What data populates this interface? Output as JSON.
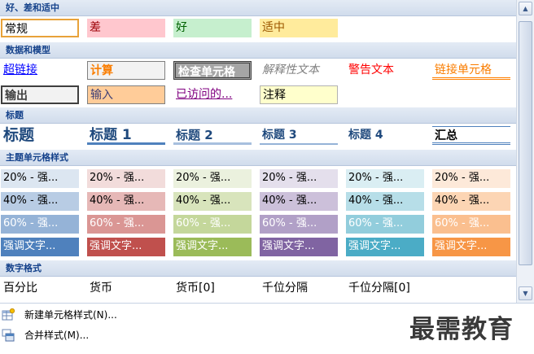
{
  "sections": [
    {
      "title": "好、差和适中",
      "cells": [
        {
          "label": "常规",
          "bg": "#ffffff",
          "fg": "#000000",
          "border": "2px solid #e8a23a",
          "weight": "normal"
        },
        {
          "label": "差",
          "bg": "#ffc7ce",
          "fg": "#9c0006",
          "weight": "normal"
        },
        {
          "label": "好",
          "bg": "#c6efce",
          "fg": "#006100",
          "weight": "normal"
        },
        {
          "label": "适中",
          "bg": "#ffeb9c",
          "fg": "#9c5700",
          "weight": "normal"
        }
      ]
    },
    {
      "title": "数据和模型",
      "cells": [
        {
          "label": "超链接",
          "bg": "#ffffff",
          "fg": "#0000ff",
          "decoration": "underline",
          "weight": "normal"
        },
        {
          "label": "计算",
          "bg": "#f2f2f2",
          "fg": "#fa7d00",
          "border": "1px solid #7f7f7f",
          "weight": "bold"
        },
        {
          "label": "检查单元格",
          "bg": "#a5a5a5",
          "fg": "#ffffff",
          "border": "3px double #3f3f3f",
          "weight": "bold"
        },
        {
          "label": "解释性文本",
          "bg": "#ffffff",
          "fg": "#7f7f7f",
          "style": "italic",
          "weight": "normal"
        },
        {
          "label": "警告文本",
          "bg": "#ffffff",
          "fg": "#ff0000",
          "weight": "normal"
        },
        {
          "label": "链接单元格",
          "bg": "#ffffff",
          "fg": "#fa7d00",
          "borderBottom": "3px double #ff8001",
          "weight": "normal"
        },
        {
          "label": "输出",
          "bg": "#f2f2f2",
          "fg": "#3f3f3f",
          "border": "2px solid #3f3f3f",
          "weight": "bold"
        },
        {
          "label": "输入",
          "bg": "#ffcc99",
          "fg": "#3f3f76",
          "border": "1px solid #7f7f7f",
          "weight": "normal"
        },
        {
          "label": "已访问的...",
          "bg": "#ffffff",
          "fg": "#800080",
          "decoration": "underline",
          "weight": "normal"
        },
        {
          "label": "注释",
          "bg": "#ffffcc",
          "fg": "#000000",
          "border": "1px solid #b2b2b2",
          "weight": "normal"
        }
      ]
    },
    {
      "title": "标题",
      "cells": [
        {
          "label": "标题",
          "bg": "#ffffff",
          "fg": "#1f497d",
          "size": "19px",
          "weight": "bold"
        },
        {
          "label": "标题 1",
          "bg": "#ffffff",
          "fg": "#1f497d",
          "size": "17px",
          "weight": "bold",
          "borderBottom": "3px solid #4f81bd"
        },
        {
          "label": "标题 2",
          "bg": "#ffffff",
          "fg": "#1f497d",
          "size": "15px",
          "weight": "bold",
          "borderBottom": "3px solid #a7bfde"
        },
        {
          "label": "标题 3",
          "bg": "#ffffff",
          "fg": "#1f497d",
          "size": "14px",
          "weight": "bold",
          "borderBottom": "2px solid #95b3d7"
        },
        {
          "label": "标题 4",
          "bg": "#ffffff",
          "fg": "#1f497d",
          "size": "14px",
          "weight": "bold"
        },
        {
          "label": "汇总",
          "bg": "#ffffff",
          "fg": "#000000",
          "size": "14px",
          "weight": "bold",
          "borderTop": "1px solid #4f81bd",
          "borderBottom": "3px double #4f81bd"
        }
      ]
    },
    {
      "title": "主题单元格样式",
      "theme": true,
      "cells": [
        {
          "label": "20% - 强...",
          "bg": "#dce6f1",
          "fg": "#000000"
        },
        {
          "label": "20% - 强...",
          "bg": "#f2dcdb",
          "fg": "#000000"
        },
        {
          "label": "20% - 强...",
          "bg": "#ebf1de",
          "fg": "#000000"
        },
        {
          "label": "20% - 强...",
          "bg": "#e4dfec",
          "fg": "#000000"
        },
        {
          "label": "20% - 强...",
          "bg": "#daeef3",
          "fg": "#000000"
        },
        {
          "label": "20% - 强...",
          "bg": "#fde9d9",
          "fg": "#000000"
        },
        {
          "label": "40% - 强...",
          "bg": "#b8cce4",
          "fg": "#000000"
        },
        {
          "label": "40% - 强...",
          "bg": "#e6b8b7",
          "fg": "#000000"
        },
        {
          "label": "40% - 强...",
          "bg": "#d8e4bc",
          "fg": "#000000"
        },
        {
          "label": "40% - 强...",
          "bg": "#ccc0da",
          "fg": "#000000"
        },
        {
          "label": "40% - 强...",
          "bg": "#b7dee8",
          "fg": "#000000"
        },
        {
          "label": "40% - 强...",
          "bg": "#fcd5b4",
          "fg": "#000000"
        },
        {
          "label": "60% - 强...",
          "bg": "#95b3d7",
          "fg": "#ffffff"
        },
        {
          "label": "60% - 强...",
          "bg": "#da9694",
          "fg": "#ffffff"
        },
        {
          "label": "60% - 强...",
          "bg": "#c4d79b",
          "fg": "#ffffff"
        },
        {
          "label": "60% - 强...",
          "bg": "#b1a0c7",
          "fg": "#ffffff"
        },
        {
          "label": "60% - 强...",
          "bg": "#92cddc",
          "fg": "#ffffff"
        },
        {
          "label": "60% - 强...",
          "bg": "#fabf8f",
          "fg": "#ffffff"
        },
        {
          "label": "强调文字...",
          "bg": "#4f81bd",
          "fg": "#ffffff"
        },
        {
          "label": "强调文字...",
          "bg": "#c0504d",
          "fg": "#ffffff"
        },
        {
          "label": "强调文字...",
          "bg": "#9bbb59",
          "fg": "#ffffff"
        },
        {
          "label": "强调文字...",
          "bg": "#8064a2",
          "fg": "#ffffff"
        },
        {
          "label": "强调文字...",
          "bg": "#4bacc6",
          "fg": "#ffffff"
        },
        {
          "label": "强调文字...",
          "bg": "#f79646",
          "fg": "#ffffff"
        }
      ]
    },
    {
      "title": "数字格式",
      "cells": [
        {
          "label": "百分比",
          "bg": "#ffffff",
          "fg": "#000000"
        },
        {
          "label": "货币",
          "bg": "#ffffff",
          "fg": "#000000"
        },
        {
          "label": "货币[0]",
          "bg": "#ffffff",
          "fg": "#000000"
        },
        {
          "label": "千位分隔",
          "bg": "#ffffff",
          "fg": "#000000"
        },
        {
          "label": "千位分隔[0]",
          "bg": "#ffffff",
          "fg": "#000000"
        }
      ]
    }
  ],
  "menu": [
    {
      "label": "新建单元格样式(N)...",
      "icon": "new-style-icon"
    },
    {
      "label": "合并样式(M)...",
      "icon": "merge-styles-icon"
    }
  ],
  "watermark": "最需教育",
  "scrollbar": {
    "up": "▲",
    "down": "▼"
  }
}
